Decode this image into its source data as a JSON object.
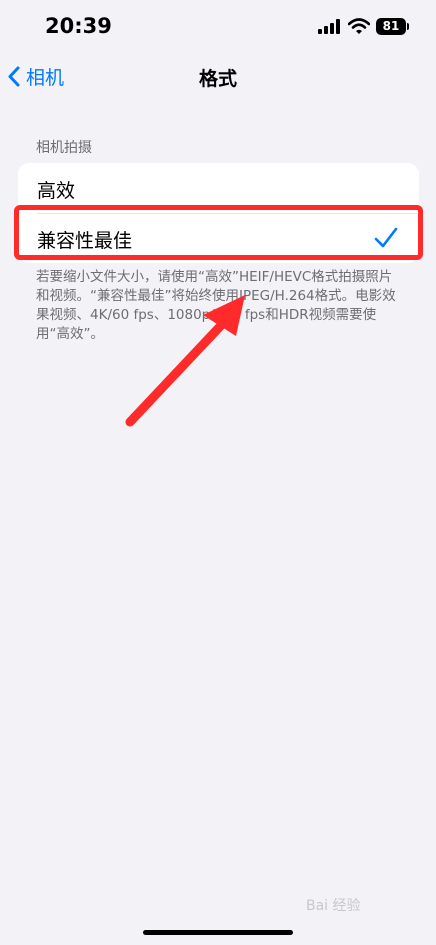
{
  "status_bar": {
    "time": "20:39",
    "battery": "81"
  },
  "nav": {
    "back_label": "相机",
    "title": "格式"
  },
  "section": {
    "header": "相机拍摄",
    "options": [
      {
        "label": "高效",
        "selected": false
      },
      {
        "label": "兼容性最佳",
        "selected": true
      }
    ],
    "footer": "若要缩小文件大小，请使用“高效”HEIF/HEVC格式拍摄照片和视频。“兼容性最佳”将始终使用JPEG/H.264格式。电影效果视频、4K/60 fps、1080p/240 fps和HDR视频需要使用“高效”。"
  },
  "colors": {
    "accent": "#007aff",
    "annotation": "#ff2a2a"
  },
  "watermark": "Bai 经验"
}
